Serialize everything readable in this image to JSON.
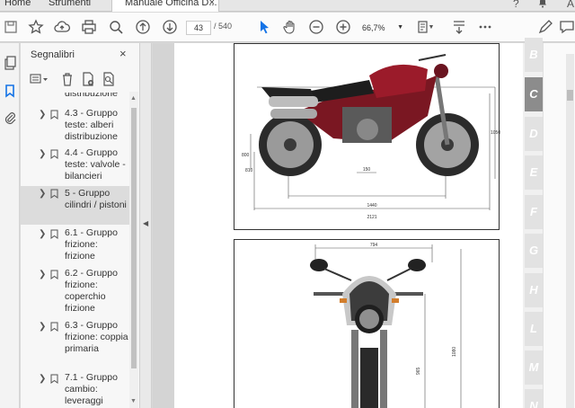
{
  "tabs": {
    "home": "Home",
    "tools": "Strumenti",
    "document": "Manuale Officina D...",
    "close": "×"
  },
  "toolbar": {
    "current_page": "43",
    "separator": "/",
    "total_pages": "540",
    "zoom": "66,7%"
  },
  "bookmarks_panel": {
    "title": "Segnalibri",
    "close": "×",
    "items": [
      {
        "label": "distribuzione",
        "selected": false
      },
      {
        "label": "4.3 - Gruppo teste: alberi distribuzione",
        "selected": false
      },
      {
        "label": "4.4 - Gruppo teste: valvole - bilancieri",
        "selected": false
      },
      {
        "label": "5 - Gruppo cilindri / pistoni",
        "selected": true
      },
      {
        "label": "6.1 - Gruppo frizione: frizione",
        "selected": false
      },
      {
        "label": "6.2 - Gruppo frizione: coperchio frizione",
        "selected": false
      },
      {
        "label": "6.3 - Gruppo frizione: coppia primaria",
        "selected": false
      },
      {
        "label": "7.1 - Gruppo cambio: leveraggi",
        "selected": false
      }
    ]
  },
  "document": {
    "fig1_dims": [
      "1440",
      "2121",
      "150",
      "800",
      "810",
      "1050"
    ],
    "fig2_dims": [
      "794",
      "1080",
      "965"
    ]
  },
  "side_tabs": [
    {
      "letter": "B",
      "active": false
    },
    {
      "letter": "C",
      "active": true
    },
    {
      "letter": "D",
      "active": false
    },
    {
      "letter": "E",
      "active": false
    },
    {
      "letter": "F",
      "active": false
    },
    {
      "letter": "G",
      "active": false
    },
    {
      "letter": "H",
      "active": false
    },
    {
      "letter": "L",
      "active": false
    },
    {
      "letter": "M",
      "active": false
    },
    {
      "letter": "N",
      "active": false
    }
  ],
  "colors": {
    "accent": "#1473e6",
    "bike_red": "#9b1b2a",
    "active_tab": "#8c8c8c"
  }
}
